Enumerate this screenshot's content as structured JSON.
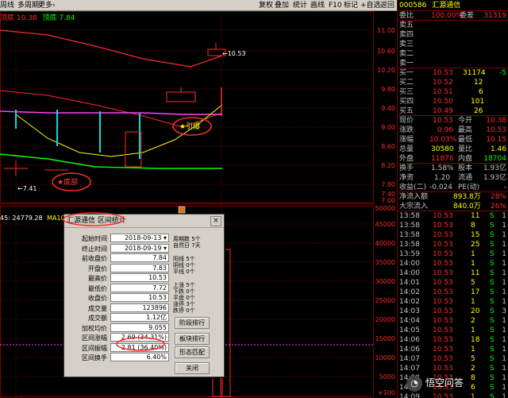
{
  "toolbar": {
    "items": [
      "周线",
      "多周期",
      "更多›",
      "复权",
      "叠加",
      "统计",
      "画线",
      "F10",
      "标记",
      "+自选",
      "返回"
    ]
  },
  "indicators": {
    "top": [
      "顶底",
      "10.38",
      "顶底",
      "7.84"
    ],
    "bottom": [
      "45: 24779.28",
      "MA10: 33..."
    ]
  },
  "main_chart": {
    "price_ticks": [
      "11.00",
      "10.60",
      "10.20",
      "9.80",
      "9.40",
      "9.00",
      "8.60",
      "8.20",
      "7.80",
      "7.40",
      "7.00"
    ],
    "high_label": "←10.53",
    "low_label": "←7.41",
    "annot_burst": "★引爆",
    "annot_bottom": "★底部"
  },
  "volume_chart": {
    "ticks": [
      "50000",
      "45000",
      "40000",
      "35000",
      "30000",
      "25000",
      "20000",
      "15000",
      "10000",
      "5000"
    ],
    "unit": "×100"
  },
  "colors": {
    "up": "#ff2a2a",
    "down": "#00e0e0",
    "yellow": "#ffff00",
    "magenta": "#ff40ff",
    "green": "#00ff00",
    "grid": "#7a0000"
  },
  "quote": {
    "code": "000586",
    "name": "汇源通信",
    "weibi_label": "委比",
    "weibi": "100.00%",
    "weicha_label": "委差",
    "weicha": "31319",
    "sells": [
      {
        "l": "卖五",
        "p": "",
        "v": ""
      },
      {
        "l": "卖四",
        "p": "",
        "v": ""
      },
      {
        "l": "卖三",
        "p": "",
        "v": ""
      },
      {
        "l": "卖二",
        "p": "",
        "v": ""
      },
      {
        "l": "卖一",
        "p": "",
        "v": ""
      }
    ],
    "buys": [
      {
        "l": "买一",
        "p": "10.53",
        "v": "31174",
        "c": "-5"
      },
      {
        "l": "买二",
        "p": "10.52",
        "v": "12",
        "c": ""
      },
      {
        "l": "买三",
        "p": "10.51",
        "v": "6",
        "c": ""
      },
      {
        "l": "买四",
        "p": "10.50",
        "v": "101",
        "c": ""
      },
      {
        "l": "买五",
        "p": "10.49",
        "v": "26",
        "c": ""
      }
    ],
    "stats": [
      {
        "l1": "现价",
        "v1": "10.53",
        "l2": "今开",
        "v2": "10.38"
      },
      {
        "l1": "涨跌",
        "v1": "0.96",
        "l2": "最高",
        "v2": "10.53"
      },
      {
        "l1": "涨幅",
        "v1": "10.03%",
        "l2": "最低",
        "v2": "10.15"
      },
      {
        "l1": "总量",
        "v1": "30580",
        "l2": "量比",
        "v2": "1.46"
      },
      {
        "l1": "外盘",
        "v1": "11876",
        "l2": "内盘",
        "v2": "18704"
      },
      {
        "l1": "换手",
        "v1": "1.58%",
        "l2": "股本",
        "v2": "1.93亿"
      },
      {
        "l1": "净资",
        "v1": "1.20",
        "l2": "流通",
        "v2": "1.93亿"
      },
      {
        "l1": "收益(二)",
        "v1": "-0.024",
        "l2": "PE(动)",
        "v2": "-"
      }
    ],
    "flows": [
      {
        "l": "净流入额",
        "v": "893.8万",
        "p": "28%"
      },
      {
        "l": "大宗流入",
        "v": "840.0万",
        "p": "26%"
      }
    ],
    "ticks": [
      {
        "t": "13:58",
        "p": "10.53",
        "v": "11",
        "d": "S",
        "n": "1"
      },
      {
        "t": "13:58",
        "p": "10.53",
        "v": "8",
        "d": "S",
        "n": "1"
      },
      {
        "t": "13:58",
        "p": "10.53",
        "v": "15",
        "d": "S",
        "n": "1"
      },
      {
        "t": "13:58",
        "p": "10.53",
        "v": "25",
        "d": "S",
        "n": "1"
      },
      {
        "t": "13:59",
        "p": "10.53",
        "v": "1",
        "d": "S",
        "n": "1"
      },
      {
        "t": "14:00",
        "p": "10.53",
        "v": "1",
        "d": "S",
        "n": "1"
      },
      {
        "t": "14:00",
        "p": "10.53",
        "v": "11",
        "d": "S",
        "n": "1"
      },
      {
        "t": "14:01",
        "p": "10.53",
        "v": "5",
        "d": "S",
        "n": "1"
      },
      {
        "t": "14:02",
        "p": "10.53",
        "v": "17",
        "d": "S",
        "n": "1"
      },
      {
        "t": "14:02",
        "p": "10.53",
        "v": "1",
        "d": "S",
        "n": "1"
      },
      {
        "t": "14:03",
        "p": "10.53",
        "v": "20",
        "d": "S",
        "n": "3"
      },
      {
        "t": "14:04",
        "p": "10.53",
        "v": "2",
        "d": "S",
        "n": "1"
      },
      {
        "t": "14:05",
        "p": "10.53",
        "v": "1",
        "d": "S",
        "n": "1"
      },
      {
        "t": "14:06",
        "p": "10.53",
        "v": "18",
        "d": "S",
        "n": "1"
      },
      {
        "t": "14:06",
        "p": "10.53",
        "v": "1",
        "d": "S",
        "n": "1"
      },
      {
        "t": "14:07",
        "p": "10.53",
        "v": "5",
        "d": "S",
        "n": "1"
      },
      {
        "t": "14:07",
        "p": "10.53",
        "v": "2",
        "d": "S",
        "n": "1"
      },
      {
        "t": "14:08",
        "p": "10.53",
        "v": "8",
        "d": "S",
        "n": "1"
      },
      {
        "t": "14:08",
        "p": "10.53",
        "v": "6",
        "d": "S",
        "n": "1"
      },
      {
        "t": "14:09",
        "p": "10.53",
        "v": "1",
        "d": "S",
        "n": "1"
      }
    ]
  },
  "dialog": {
    "title": "汇源通信 区间统计",
    "close": "×",
    "fields": [
      {
        "l": "起始时间",
        "v": "2018-09-13 ▾"
      },
      {
        "l": "终止时间",
        "v": "2018-09-19 ▾"
      },
      {
        "l": "前收盘价",
        "v": "7.84"
      },
      {
        "l": "开盘价",
        "v": "7.83"
      },
      {
        "l": "最高价",
        "v": "10.53"
      },
      {
        "l": "最低价",
        "v": "7.72"
      },
      {
        "l": "收盘价",
        "v": "10.53"
      },
      {
        "l": "成交量",
        "v": "123896"
      },
      {
        "l": "成交额",
        "v": "1.12亿"
      },
      {
        "l": "加权均价",
        "v": "9.055"
      },
      {
        "l": "区间涨幅",
        "v": "2.69 (34.31%)"
      },
      {
        "l": "区间振幅",
        "v": "2.81 (36.40%)"
      },
      {
        "l": "区间换手",
        "v": "6.40%"
      }
    ],
    "period": [
      "周期数  5个",
      "自然日  7天"
    ],
    "counts1": [
      "阳线  5个",
      "阴线  0个",
      "平线  0个"
    ],
    "counts2": [
      "上涨  5个",
      "下跌  0个",
      "平盘  0个",
      "涨停  3个",
      "跌停  0个"
    ],
    "buttons": [
      "阶段排行",
      "板块排行",
      "形态匹配",
      "关闭"
    ]
  },
  "watermark": "悟空问答"
}
